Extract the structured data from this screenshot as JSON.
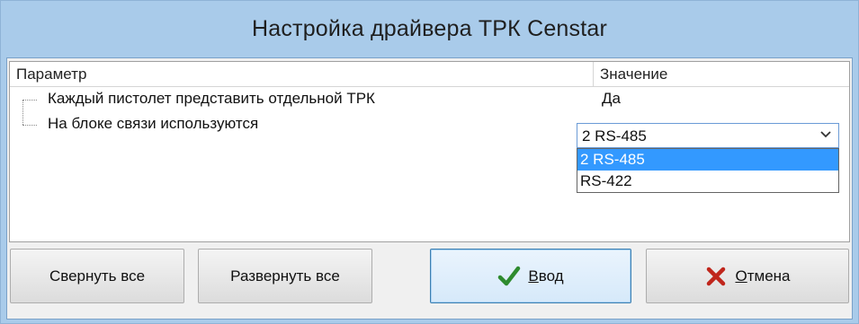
{
  "window": {
    "title": "Настройка драйвера ТРК Censtar"
  },
  "grid": {
    "columns": {
      "parameter": "Параметр",
      "value": "Значение"
    },
    "rows": [
      {
        "label": "Каждый пистолет представить отдельной ТРК",
        "value": "Да"
      },
      {
        "label": "На блоке связи используются",
        "value": "2 RS-485"
      }
    ]
  },
  "combo": {
    "selected": "2 RS-485",
    "options": [
      "2 RS-485",
      "RS-422"
    ],
    "highlighted_index": 0
  },
  "buttons": {
    "collapse_all": "Свернуть все",
    "expand_all": "Развернуть все",
    "ok_first": "В",
    "ok_rest": "вод",
    "cancel_first": "О",
    "cancel_rest": "тмена"
  },
  "colors": {
    "title_bar": "#a9cbea",
    "selection": "#3399ff",
    "ok_icon": "#2e8b2e",
    "cancel_icon": "#c0261c"
  },
  "icons": {
    "ok": "checkmark-icon",
    "cancel": "x-icon",
    "dropdown": "chevron-down-icon"
  }
}
